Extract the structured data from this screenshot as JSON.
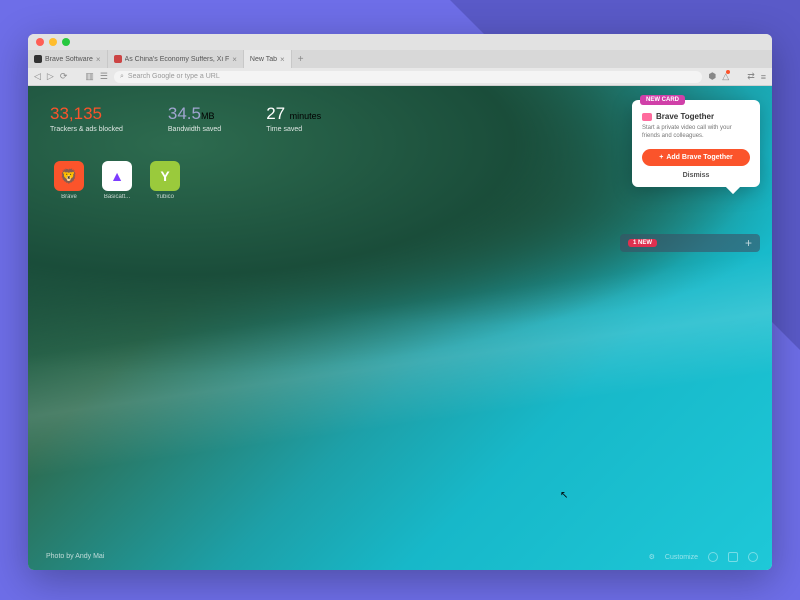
{
  "tabs": [
    {
      "title": "Brave Software",
      "active": false
    },
    {
      "title": "As China's Economy Suffers, Xi F",
      "active": false
    },
    {
      "title": "New Tab",
      "active": true
    }
  ],
  "addressBar": {
    "placeholder": "Search Google or type a URL"
  },
  "stats": {
    "trackers": {
      "value": "33,135",
      "label": "Trackers & ads blocked"
    },
    "bandwidth": {
      "value": "34.5",
      "unit": "MB",
      "label": "Bandwidth saved"
    },
    "time": {
      "value": "27",
      "unit": "minutes",
      "label": "Time saved"
    }
  },
  "favorites": [
    {
      "name": "Brave",
      "glyph": "🦁"
    },
    {
      "name": "Basicatt...",
      "glyph": "▲"
    },
    {
      "name": "Yubico",
      "glyph": "Y"
    }
  ],
  "card": {
    "tag": "NEW CARD",
    "title": "Brave Together",
    "description": "Start a private video call with your friends and colleagues.",
    "button": "Add Brave Together",
    "dismiss": "Dismiss"
  },
  "pill": {
    "badge": "1 NEW"
  },
  "credit": "Photo by Andy Mai",
  "customize": "Customize"
}
